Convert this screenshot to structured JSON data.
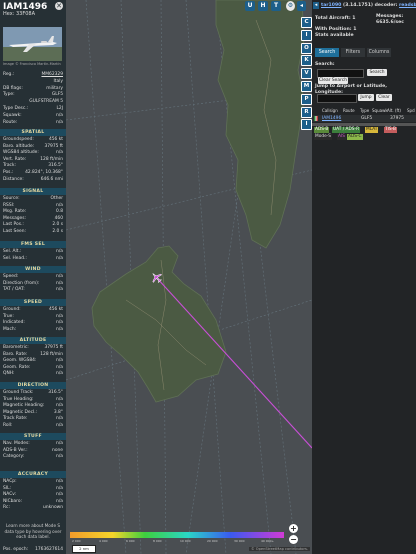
{
  "header": {
    "callsign": "IAM1496",
    "hex_label": "Hex: 33F08A",
    "close_icon": "close-icon"
  },
  "photo": {
    "credit": "Image © Francisco Martín-Martín"
  },
  "info": [
    {
      "k": "Reg.:",
      "v": "MM62329",
      "link": true
    },
    {
      "k": "",
      "v": "Italy"
    },
    {
      "k": "DB flags:",
      "v": "military"
    },
    {
      "k": "Type:",
      "v": "GLF5"
    },
    {
      "k": "",
      "v": "GULFSTREAM 5"
    },
    {
      "k": "Type Desc.:",
      "v": "L2J"
    },
    {
      "k": "Squawk:",
      "v": "n/a"
    },
    {
      "k": "Route:",
      "v": "n/a"
    }
  ],
  "sections": {
    "spatial": {
      "title": "SPATIAL",
      "rows": [
        {
          "k": "Groundspeed:",
          "v": "456 kt"
        },
        {
          "k": "Baro. altitude:",
          "v": "37975 ft"
        },
        {
          "k": "WGS84 altitude:",
          "v": "n/a"
        },
        {
          "k": "Vert. Rate:",
          "v": "128 ft/min"
        },
        {
          "k": "Track:",
          "v": "316.5°"
        },
        {
          "k": "Pos.:",
          "v": "42.824°, 10.368°"
        },
        {
          "k": "Distance:",
          "v": "646.6 nmi"
        }
      ]
    },
    "signal": {
      "title": "SIGNAL",
      "rows": [
        {
          "k": "Source:",
          "v": "Other"
        },
        {
          "k": "RSSI:",
          "v": "n/a"
        },
        {
          "k": "Msg. Rate:",
          "v": "0.8"
        },
        {
          "k": "Messages:",
          "v": "460"
        },
        {
          "k": "Last Pos.:",
          "v": "2.0 s"
        },
        {
          "k": "Last Seen:",
          "v": "2.0 s"
        }
      ]
    },
    "fms": {
      "title": "FMS SEL",
      "rows": [
        {
          "k": "Sel. Alt.:",
          "v": "n/a"
        },
        {
          "k": "Sel. Head.:",
          "v": "n/a"
        }
      ]
    },
    "wind": {
      "title": "WIND",
      "rows": [
        {
          "k": "Speed:",
          "v": "n/a"
        },
        {
          "k": "Direction (from):",
          "v": "n/a"
        },
        {
          "k": "TAT / OAT:",
          "v": "n/a"
        }
      ]
    },
    "speed": {
      "title": "SPEED",
      "rows": [
        {
          "k": "Ground:",
          "v": "456 kt"
        },
        {
          "k": "True:",
          "v": "n/a"
        },
        {
          "k": "Indicated:",
          "v": "n/a"
        },
        {
          "k": "Mach:",
          "v": "n/a"
        }
      ]
    },
    "altitude": {
      "title": "ALTITUDE",
      "rows": [
        {
          "k": "Barometric:",
          "v": "37975 ft"
        },
        {
          "k": "Baro. Rate:",
          "v": "128 ft/min"
        },
        {
          "k": "Geom. WGS84:",
          "v": "n/a"
        },
        {
          "k": "Geom. Rate:",
          "v": "n/a"
        },
        {
          "k": "QNH:",
          "v": "n/a"
        }
      ]
    },
    "direction": {
      "title": "DIRECTION",
      "rows": [
        {
          "k": "Ground Track:",
          "v": "316.5°"
        },
        {
          "k": "True Heading:",
          "v": "n/a"
        },
        {
          "k": "Magnetic Heading:",
          "v": "n/a"
        },
        {
          "k": "Magnetic Decl.:",
          "v": "3.8°"
        },
        {
          "k": "Track Rate:",
          "v": "n/a"
        },
        {
          "k": "Roll:",
          "v": "n/a"
        }
      ]
    },
    "stuff": {
      "title": "STUFF",
      "rows": [
        {
          "k": "Nav. Modes:",
          "v": "n/a"
        },
        {
          "k": "ADS-B Ver.:",
          "v": "none"
        },
        {
          "k": "Category:",
          "v": "n/a"
        }
      ]
    },
    "accuracy": {
      "title": "ACCURACY",
      "rows": [
        {
          "k": "NACp:",
          "v": "n/a"
        },
        {
          "k": "SIL:",
          "v": "n/a"
        },
        {
          "k": "NACv:",
          "v": "n/a"
        },
        {
          "k": "NICbaro:",
          "v": "n/a"
        },
        {
          "k": "Rc:",
          "v": "unknown"
        }
      ]
    }
  },
  "learn_more": "Learn more about Mode S data type by hovering over each data label.",
  "pos_epoch": {
    "k": "Pos. epoch:",
    "v": "1763627614"
  },
  "map": {
    "top_buttons": [
      "U",
      "H",
      "T"
    ],
    "side_buttons": [
      "C",
      "I",
      "O",
      "K",
      "V",
      "M",
      "P",
      "R",
      "I"
    ],
    "zoom_in": "+",
    "zoom_out": "−",
    "scale": "2 nm",
    "attribution": "© OpenStreetMap contributors.",
    "altitude_legend": [
      "2 000",
      "4 000",
      "6 000",
      "8 000",
      "10 000",
      "20 000",
      "30 000",
      "40 000+"
    ],
    "colors": {
      "land": "#4b5a43",
      "sea": "#4a4e52",
      "track": "#c84fd6"
    }
  },
  "right": {
    "version_link": "tar1090",
    "version": "(3.14.1751) decoder:",
    "decoder_link": "readsb",
    "total_label": "Total Aircraft:",
    "total_value": "1",
    "messages_label": "Messages:",
    "messages_value": "6635.6/sec",
    "position_label": "With Position:",
    "position_value": "1",
    "stats": "Stats available",
    "tabs": [
      "Search",
      "Filters",
      "Columns"
    ],
    "search_label": "Search:",
    "search_placeholder": "",
    "search_button": "Search",
    "clear_search": "Clear Search",
    "jump_label": "Jump to Airport or Latitude, Longitude:",
    "jump_button": "Jump",
    "clear_button": "Clear",
    "columns": [
      "Callsign",
      "Route",
      "Type",
      "Squawk",
      "Alt. (ft)",
      "Spd"
    ],
    "row": {
      "callsign": "IAM1496",
      "type": "GLF5",
      "alt": "37975"
    },
    "legend": [
      {
        "label": "ADS-B",
        "bg": "#5a8a3a",
        "fg": "#fff"
      },
      {
        "label": "UAT / ADS-R",
        "bg": "#3c7f3c",
        "fg": "#fff"
      },
      {
        "label": "MLAT",
        "bg": "#d7b73a",
        "fg": "#222"
      },
      {
        "label": "TIS-B",
        "bg": "#c45d5d",
        "fg": "#fff"
      },
      {
        "label": "Mode-S",
        "bg": "#2a2a2a",
        "fg": "#ddd"
      },
      {
        "label": "AIS",
        "bg": "#2a2a2a",
        "fg": "#c45dc4"
      },
      {
        "label": "ADS-C",
        "bg": "#8cb84a",
        "fg": "#222"
      }
    ]
  }
}
